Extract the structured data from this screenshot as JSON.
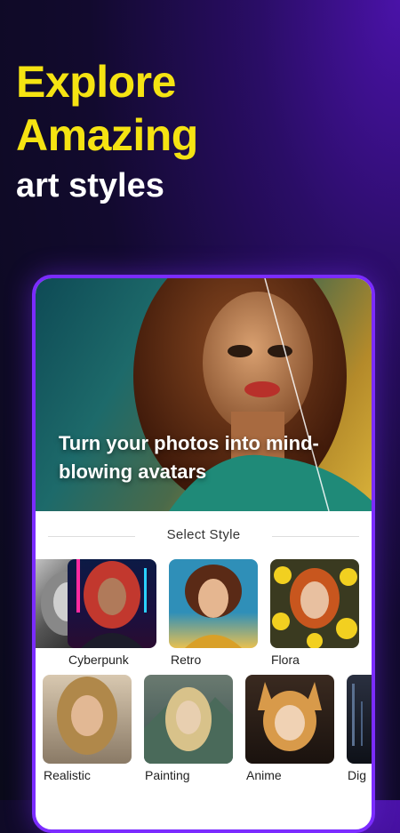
{
  "headline": {
    "line1": "Explore",
    "line2": "Amazing",
    "line3": "art styles"
  },
  "hero": {
    "caption": "Turn your photos into mind-blowing avatars"
  },
  "section": {
    "title": "Select Style"
  },
  "styles_row1": [
    {
      "label": "",
      "icon": "grayscale-portrait"
    },
    {
      "label": "Cyberpunk",
      "icon": "cyberpunk-portrait"
    },
    {
      "label": "Retro",
      "icon": "retro-portrait"
    },
    {
      "label": "Flora",
      "icon": "flora-portrait"
    }
  ],
  "styles_row2": [
    {
      "label": "Realistic",
      "icon": "realistic-portrait"
    },
    {
      "label": "Painting",
      "icon": "painting-portrait"
    },
    {
      "label": "Anime",
      "icon": "anime-portrait"
    },
    {
      "label": "Dig",
      "icon": "digital-portrait"
    }
  ],
  "colors": {
    "accent": "#7b2cff",
    "headline_yellow": "#f5e312"
  }
}
